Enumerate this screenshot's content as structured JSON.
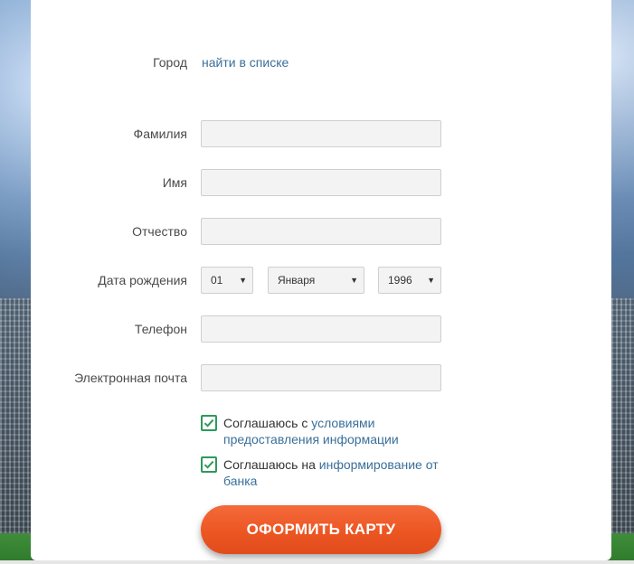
{
  "form": {
    "city": {
      "label": "Город",
      "link": "найти в списке"
    },
    "last_name": {
      "label": "Фамилия",
      "value": ""
    },
    "first_name": {
      "label": "Имя",
      "value": ""
    },
    "middle_name": {
      "label": "Отчество",
      "value": ""
    },
    "birth_date": {
      "label": "Дата рождения",
      "day": "01",
      "month": "Января",
      "year": "1996"
    },
    "phone": {
      "label": "Телефон",
      "value": ""
    },
    "email": {
      "label": "Электронная почта",
      "value": ""
    },
    "consent_terms": {
      "checked": true,
      "prefix": "Соглашаюсь с ",
      "link": "условиями предоставления информации"
    },
    "consent_marketing": {
      "checked": true,
      "prefix": "Соглашаюсь на ",
      "link": "информирование от банка"
    },
    "submit_label": "ОФОРМИТЬ КАРТУ"
  },
  "colors": {
    "accent_orange": "#ec5623",
    "link_blue": "#3a6f9a",
    "check_green": "#2d9a5a"
  }
}
